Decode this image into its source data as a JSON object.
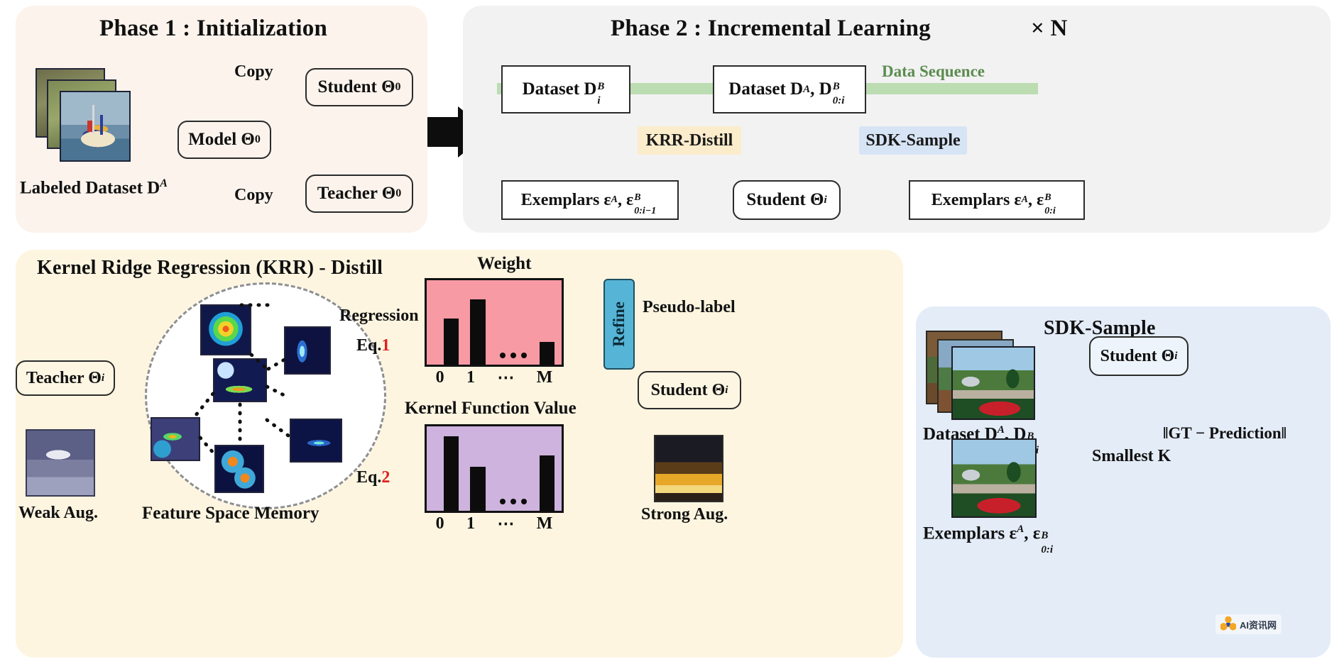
{
  "phase1": {
    "title": "Phase 1 : Initialization",
    "dataset_caption": "Labeled Dataset D",
    "dataset_sup": "A",
    "model_box": "Model Θ",
    "model_sub": "0",
    "copy_top": "Copy",
    "copy_bottom": "Copy",
    "student_box": "Student Θ",
    "student_sub": "0",
    "teacher_box": "Teacher Θ",
    "teacher_sub": "0",
    "bg": "#fbf3ec"
  },
  "phase2": {
    "title": "Phase 2 : Incremental Learning",
    "repeat": "× N",
    "data_sequence": "Data Sequence",
    "data_sequence_color": "#5b8c4f",
    "dataset_b": "Dataset D",
    "dataset_b_sup": "B",
    "dataset_b_sub": "i",
    "dataset_ab": "Dataset D",
    "dataset_ab_sup_a": "A",
    "dataset_ab_2": ", D",
    "dataset_ab_sup_b": "B",
    "dataset_ab_sub_b": "0:i",
    "krr_tag": "KRR-Distill",
    "krr_tag_bg": "#fbeccb",
    "sdk_tag": "SDK-Sample",
    "sdk_tag_bg": "#d6e4f5",
    "exemplars_left": "Exemplars ε",
    "exemplars_left_sup": "A",
    "exemplars_left_2": ", ε",
    "exemplars_left_sup2": "B",
    "exemplars_left_sub2": "0:i−1",
    "student_box": "Student Θ",
    "student_sub": "i",
    "exemplars_right": "Exemplars ε",
    "exemplars_right_sup": "A",
    "exemplars_right_2": ", ε",
    "exemplars_right_sup2": "B",
    "exemplars_right_sub2": "0:i",
    "bg": "#f2f2f2"
  },
  "krr": {
    "title": "Kernel Ridge Regression (KRR) - Distill",
    "teacher_box": "Teacher Θ",
    "teacher_sub": "i",
    "weak_aug": "Weak Aug.",
    "memory_caption": "Feature Space Memory",
    "regression_label": "Regression",
    "eq1_prefix": "Eq.",
    "eq1_num": "1",
    "eq2_prefix": "Eq.",
    "eq2_num": "2",
    "eq_num_color": "#e02020",
    "weight_title": "Weight",
    "kernel_title": "Kernel Function Value",
    "refine_label": "Refine",
    "refine_bg": "#56b4d6",
    "pseudo_label": "Pseudo-label",
    "student_box": "Student Θ",
    "student_sub": "i",
    "strong_aug": "Strong Aug.",
    "bg": "#fdf5e0"
  },
  "sdk": {
    "title": "SDK-Sample",
    "dataset_caption": "Dataset D",
    "dataset_sup_a": "A",
    "dataset_mid": ", D",
    "dataset_sup_b": "B",
    "dataset_sub_b": "0:i",
    "student_box": "Student Θ",
    "student_sub": "i",
    "norm_expr": "‖GT − Prediction‖",
    "smallest_k": "Smallest K",
    "exemplars_caption": "Exemplars  ε",
    "exemplars_sup_a": "A",
    "exemplars_mid": ", ε",
    "exemplars_sup_b": "B",
    "exemplars_sub_b": "0:i",
    "bg": "#e3ecf7"
  },
  "chart_data": [
    {
      "type": "bar",
      "title": "Weight",
      "categories": [
        "0",
        "1",
        "⋯",
        "M"
      ],
      "values": [
        0.52,
        0.74,
        0.0,
        0.26
      ],
      "ylim": [
        0,
        1
      ],
      "plot_bg": "#f79aa3",
      "bar_color": "#0c0c0c",
      "xlabel": "",
      "ylabel": ""
    },
    {
      "type": "bar",
      "title": "Kernel Function Value",
      "categories": [
        "0",
        "1",
        "⋯",
        "M"
      ],
      "values": [
        0.84,
        0.5,
        0.0,
        0.62
      ],
      "ylim": [
        0,
        1
      ],
      "plot_bg": "#cdb3dd",
      "bar_color": "#0c0c0c",
      "xlabel": "",
      "ylabel": ""
    }
  ],
  "watermark": {
    "text": "AI资讯网"
  }
}
